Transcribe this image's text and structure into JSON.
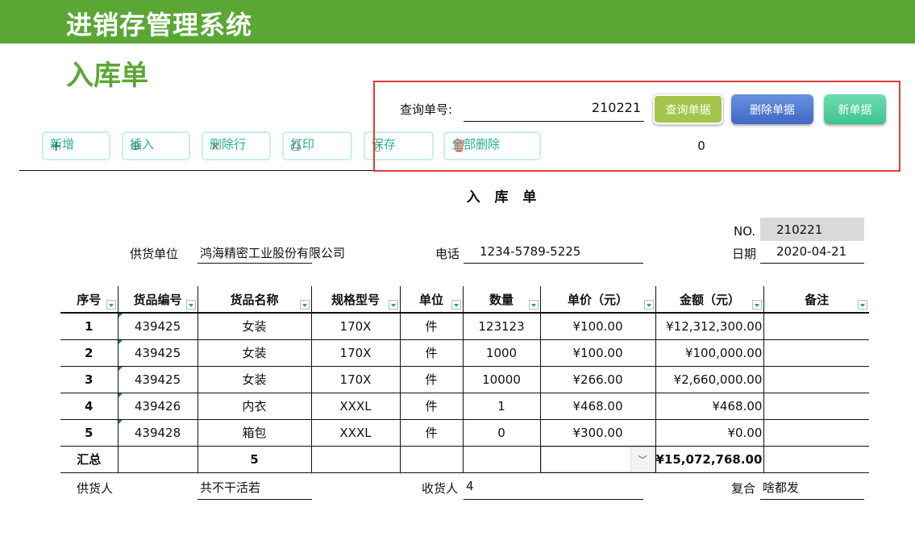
{
  "app": {
    "title": "进销存管理系统",
    "page_title": "入库单"
  },
  "toolbar": {
    "items": [
      {
        "label": "新增",
        "icon": "plus-icon",
        "glyph": "+"
      },
      {
        "label": "插入",
        "icon": "insert-icon",
        "glyph": "⊕"
      },
      {
        "label": "删除行",
        "icon": "close-icon",
        "glyph": "×"
      },
      {
        "label": "打印",
        "icon": "printer-icon",
        "glyph": "⎙"
      },
      {
        "label": "保存",
        "icon": "save-icon",
        "glyph": "▯"
      },
      {
        "label": "全部删除",
        "icon": "trash-icon",
        "glyph": "🗑"
      }
    ]
  },
  "query": {
    "label": "查询单号:",
    "value": "210221",
    "buttons": {
      "query": "查询单据",
      "delete": "删除单据",
      "new": "新单据"
    },
    "count": "0"
  },
  "colors": {
    "brand": "#5aa736",
    "query_btn": "#a3c54a",
    "delete_btn": "#4a74d1",
    "new_btn": "#4ccf9e",
    "highlight_box": "#e23b3b"
  },
  "document": {
    "title": "入 库 单",
    "no_label": "NO.",
    "no_value": "210221",
    "supplier_label": "供货单位",
    "supplier_value": "鸿海精密工业股份有限公司",
    "phone_label": "电话",
    "phone_value": "1234-5789-5225",
    "date_label": "日期",
    "date_value": "2020-04-21"
  },
  "table": {
    "headers": [
      "序号",
      "货品编号",
      "货品名称",
      "规格型号",
      "单位",
      "数量",
      "单价（元）",
      "金额（元）",
      "备注"
    ],
    "rows": [
      [
        "1",
        "439425",
        "女装",
        "170X",
        "件",
        "123123",
        "¥100.00",
        "¥12,312,300.00",
        ""
      ],
      [
        "2",
        "439425",
        "女装",
        "170X",
        "件",
        "1000",
        "¥100.00",
        "¥100,000.00",
        ""
      ],
      [
        "3",
        "439425",
        "女装",
        "170X",
        "件",
        "10000",
        "¥266.00",
        "¥2,660,000.00",
        ""
      ],
      [
        "4",
        "439426",
        "内衣",
        "XXXL",
        "件",
        "1",
        "¥468.00",
        "¥468.00",
        ""
      ],
      [
        "5",
        "439428",
        "箱包",
        "XXXL",
        "件",
        "0",
        "¥300.00",
        "¥0.00",
        ""
      ]
    ],
    "summary": {
      "label": "汇总",
      "count": "5",
      "total": "¥15,072,768.00"
    }
  },
  "footer": {
    "supplier_person_label": "供货人",
    "supplier_person_value": "共不干活若",
    "receiver_label": "收货人",
    "receiver_value": "4",
    "checker_label": "复合",
    "checker_value": "啥都发"
  }
}
